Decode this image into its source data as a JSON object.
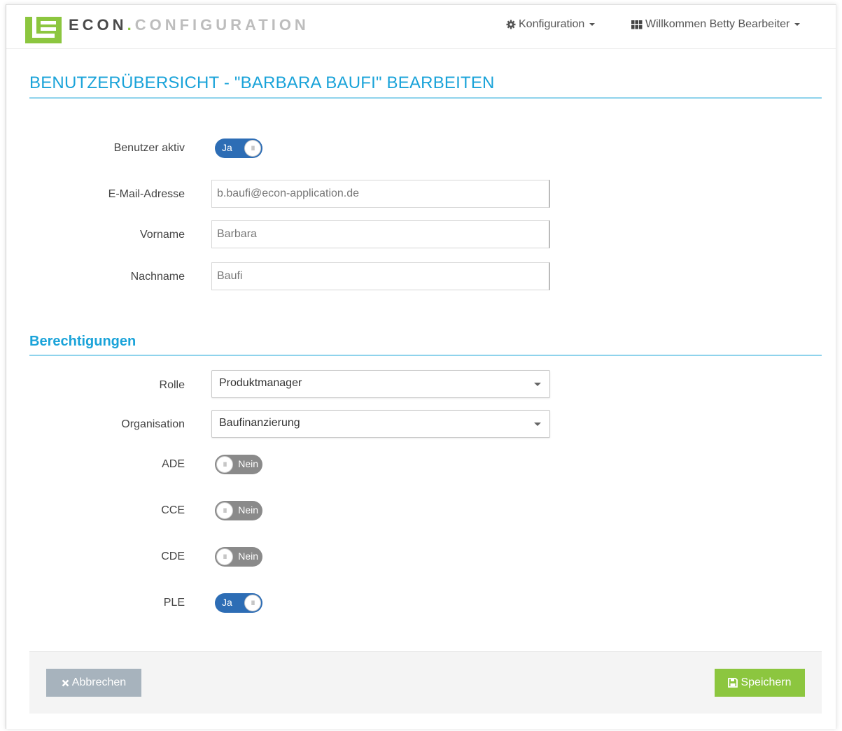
{
  "header": {
    "brand_part1": "ECON",
    "brand_dot": ".",
    "brand_part2": "CONFIGURATION",
    "config_menu": "Konfiguration",
    "user_menu": "Willkommen Betty Bearbeiter"
  },
  "page": {
    "title": "BENUTZERÜBERSICHT - \"BARBARA BAUFI\" BEARBEITEN"
  },
  "user_form": {
    "active_label": "Benutzer aktiv",
    "active_toggle": {
      "on": true,
      "text": "Ja"
    },
    "email_label": "E-Mail-Adresse",
    "email_value": "b.baufi@econ-application.de",
    "firstname_label": "Vorname",
    "firstname_value": "Barbara",
    "lastname_label": "Nachname",
    "lastname_value": "Baufi"
  },
  "permissions": {
    "section_title": "Berechtigungen",
    "role_label": "Rolle",
    "role_value": "Produktmanager",
    "org_label": "Organisation",
    "org_value": "Baufinanzierung",
    "toggles": [
      {
        "label": "ADE",
        "on": false,
        "text": "Nein"
      },
      {
        "label": "CCE",
        "on": false,
        "text": "Nein"
      },
      {
        "label": "CDE",
        "on": false,
        "text": "Nein"
      },
      {
        "label": "PLE",
        "on": true,
        "text": "Ja"
      }
    ]
  },
  "footer": {
    "cancel_label": "Abbrechen",
    "save_label": "Speichern"
  },
  "colors": {
    "accent_blue": "#1aa3d9",
    "toggle_on": "#2d6db5",
    "toggle_off": "#8a8a8a",
    "save_green": "#8cc63f",
    "cancel_gray": "#a7b3bd"
  }
}
